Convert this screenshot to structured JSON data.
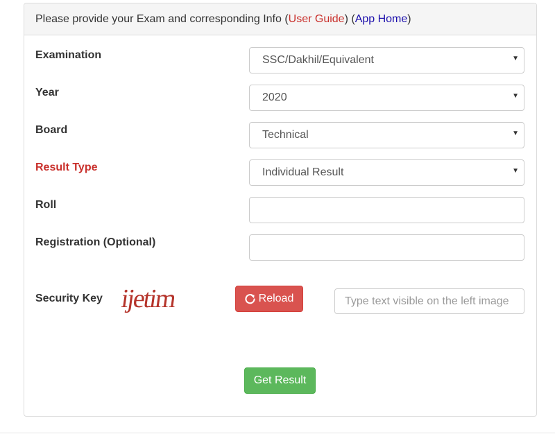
{
  "heading": {
    "text_before": "Please provide your Exam and corresponding Info (",
    "user_guide": "User Guide",
    "text_mid": ") (",
    "app_home": "App Home",
    "text_after": ")"
  },
  "fields": {
    "examination": {
      "label": "Examination",
      "value": "SSC/Dakhil/Equivalent"
    },
    "year": {
      "label": "Year",
      "value": "2020"
    },
    "board": {
      "label": "Board",
      "value": "Technical"
    },
    "result_type": {
      "label": "Result Type",
      "value": "Individual Result"
    },
    "roll": {
      "label": "Roll",
      "value": ""
    },
    "registration": {
      "label": "Registration (Optional)",
      "value": ""
    }
  },
  "security": {
    "label": "Security Key",
    "captcha_text": "ijetim",
    "reload_label": "Reload",
    "placeholder": "Type text visible on the left image"
  },
  "submit_label": "Get Result",
  "colors": {
    "danger": "#d9534f",
    "success": "#5cb85c",
    "required_label": "#c9302c",
    "link_blue": "#1a0dab"
  },
  "icons": {
    "select_caret": "caret-down-icon",
    "reload": "refresh-icon"
  }
}
